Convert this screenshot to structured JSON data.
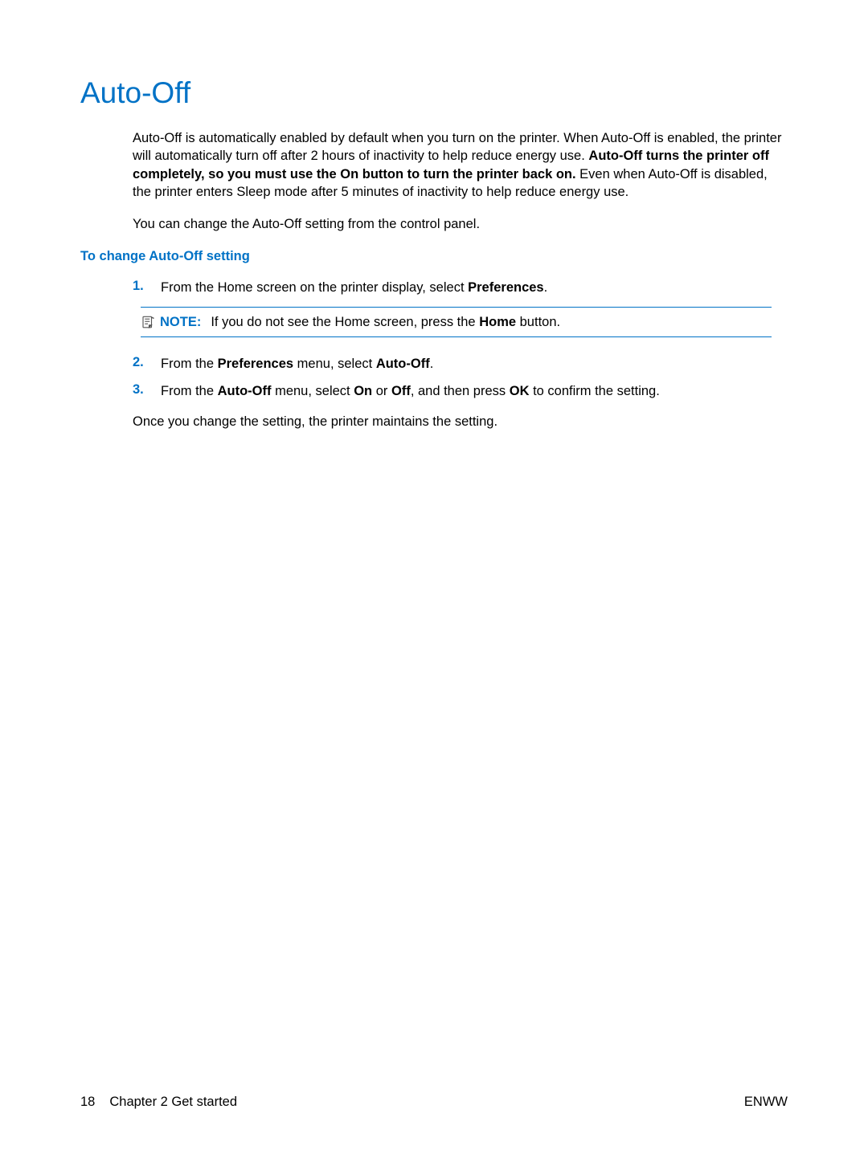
{
  "title": "Auto-Off",
  "intro": {
    "part1": "Auto-Off is automatically enabled by default when you turn on the printer. When Auto-Off is enabled, the printer will automatically turn off after 2 hours of inactivity to help reduce energy use. ",
    "bold1": "Auto-Off turns the printer off completely, so you must use the On button to turn the printer back on.",
    "part2": " Even when Auto-Off is disabled, the printer enters Sleep mode after 5 minutes of inactivity to help reduce energy use."
  },
  "intro2": "You can change the Auto-Off setting from the control panel.",
  "subhead": "To change Auto-Off setting",
  "steps": [
    {
      "num": "1.",
      "pre": "From the Home screen on the printer display, select ",
      "bold": "Preferences",
      "post": "."
    },
    {
      "num": "2.",
      "pre": "From the ",
      "bold1": "Preferences",
      "mid": " menu, select ",
      "bold2": "Auto-Off",
      "post": "."
    },
    {
      "num": "3.",
      "pre": "From the ",
      "bold1": "Auto-Off",
      "mid1": " menu, select ",
      "bold2": "On",
      "mid2": " or ",
      "bold3": "Off",
      "mid3": ", and then press ",
      "bold4": "OK",
      "post": " to confirm the setting."
    }
  ],
  "note": {
    "label": "NOTE:",
    "pre": "If you do not see the Home screen, press the ",
    "bold": "Home",
    "post": " button."
  },
  "closing": "Once you change the setting, the printer maintains the setting.",
  "footer": {
    "page": "18",
    "chapter": "Chapter 2   Get started",
    "lang": "ENWW"
  }
}
